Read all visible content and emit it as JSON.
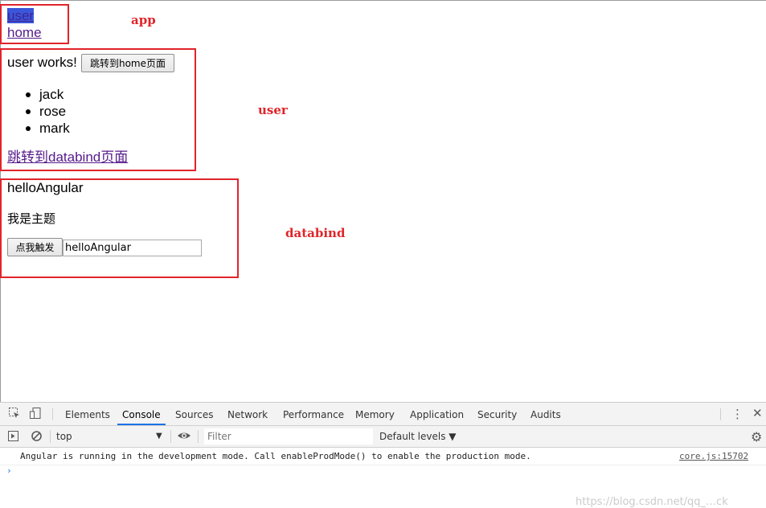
{
  "app_box": {
    "label": "app",
    "links": [
      "user",
      "home"
    ]
  },
  "user_box": {
    "label": "user",
    "heading": "user works!",
    "goto_home_button": "跳转到home页面",
    "names": [
      "jack",
      "rose",
      "mark"
    ],
    "goto_databind_link": "跳转到databind页面"
  },
  "databind_box": {
    "label": "databind",
    "title": "helloAngular",
    "subject": "我是主题",
    "trigger_button": "点我触发",
    "input_value": "helloAngular"
  },
  "devtools": {
    "tabs": [
      "Elements",
      "Console",
      "Sources",
      "Network",
      "Performance",
      "Memory",
      "Application",
      "Security",
      "Audits"
    ],
    "active_tab": "Console",
    "context": "top",
    "filter_placeholder": "Filter",
    "levels": "Default levels ▼",
    "message": "Angular is running in the development mode. Call enableProdMode() to enable the production mode.",
    "message_source": "core.js:15702",
    "watermark": "https://blog.csdn.net/qq_…ck"
  },
  "colors": {
    "annotation_red": "#e0242a",
    "link_visited": "#551a8b",
    "selection_blue": "#3b56d9",
    "devtools_active": "#1a73e8"
  }
}
